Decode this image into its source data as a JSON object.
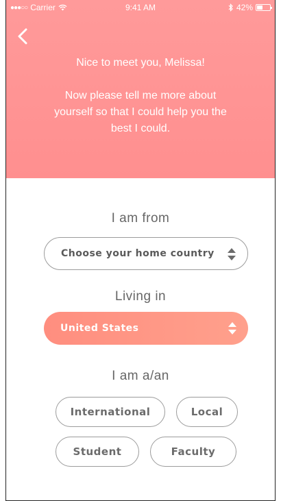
{
  "status_bar": {
    "signal": "●●●○○",
    "carrier": "Carrier",
    "time": "9:41 AM",
    "battery": "42%"
  },
  "header": {
    "greeting": "Nice to meet you, Melissa!",
    "prompt": "Now please tell me more about yourself so that I could help you the best I could."
  },
  "form": {
    "from_label": "I am from",
    "home_country_placeholder": "Choose your home country",
    "living_label": "Living in",
    "living_value": "United States",
    "role_label": "I am a/an",
    "options": [
      "International",
      "Local",
      "Student",
      "Faculty"
    ]
  },
  "colors": {
    "accent": "#ff8f8f",
    "button_gradient_start": "#ff8e7f",
    "button_gradient_end": "#ffa08c",
    "outline": "#9b9b9b"
  }
}
